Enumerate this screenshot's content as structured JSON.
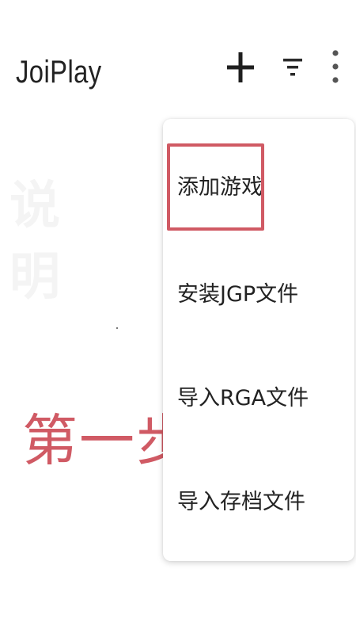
{
  "app_bar": {
    "title": "JoiPlay",
    "icons": {
      "add": "plus-icon",
      "filter": "filter-icon",
      "more": "more-vertical-icon"
    }
  },
  "background": {
    "faint_text": "说明",
    "step_label": "第一步",
    "step_color": "#d05a64"
  },
  "menu": {
    "items": [
      {
        "label": "添加游戏",
        "highlighted": true
      },
      {
        "label": "安装JGP文件"
      },
      {
        "label": "导入RGA文件"
      },
      {
        "label": "导入存档文件"
      }
    ],
    "highlight_color": "#d05a64"
  }
}
